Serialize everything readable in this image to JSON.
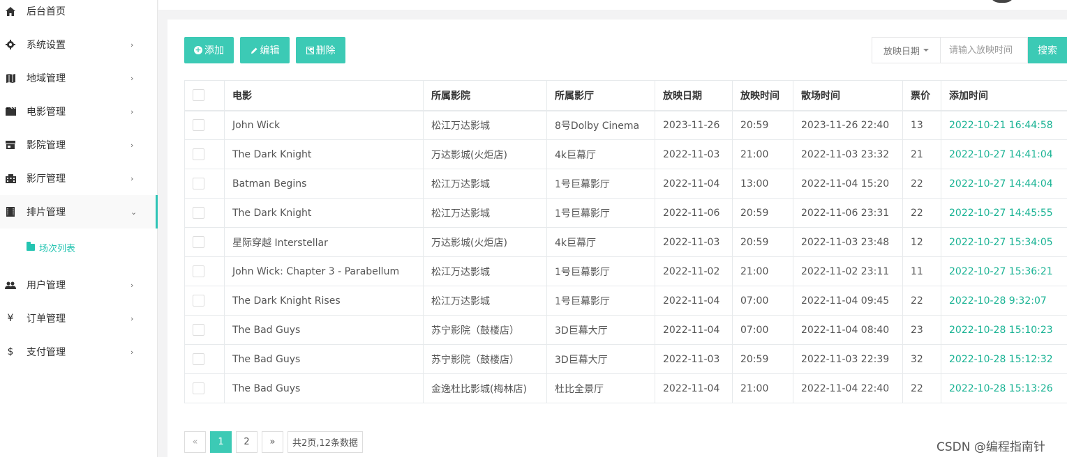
{
  "sidebar": {
    "items": [
      {
        "label": "后台首页",
        "icon": "home-icon"
      },
      {
        "label": "系统设置",
        "icon": "gear-icon"
      },
      {
        "label": "地域管理",
        "icon": "map-icon"
      },
      {
        "label": "电影管理",
        "icon": "film-icon"
      },
      {
        "label": "影院管理",
        "icon": "store-icon"
      },
      {
        "label": "影厅管理",
        "icon": "building-icon"
      },
      {
        "label": "排片管理",
        "icon": "schedule-icon"
      },
      {
        "label": "用户管理",
        "icon": "users-icon"
      },
      {
        "label": "订单管理",
        "icon": "yen-icon"
      },
      {
        "label": "支付管理",
        "icon": "dollar-icon"
      }
    ],
    "sub_item": {
      "label": "场次列表",
      "icon": "folder-icon"
    }
  },
  "toolbar": {
    "add_label": "添加",
    "edit_label": "编辑",
    "delete_label": "删除"
  },
  "search": {
    "field_select": "放映日期",
    "placeholder": "请输入放映时间",
    "button_label": "搜索"
  },
  "table": {
    "headers": [
      "电影",
      "所属影院",
      "所属影厅",
      "放映日期",
      "放映时间",
      "散场时间",
      "票价",
      "添加时间"
    ],
    "rows": [
      [
        "John Wick",
        "松江万达影城",
        "8号Dolby Cinema",
        "2023-11-26",
        "20:59",
        "2023-11-26 22:40",
        "13",
        "2022-10-21 16:44:58"
      ],
      [
        "The Dark Knight",
        "万达影城(火炬店)",
        "4k巨幕厅",
        "2022-11-03",
        "21:00",
        "2022-11-03 23:32",
        "21",
        "2022-10-27 14:41:04"
      ],
      [
        "Batman Begins",
        "松江万达影城",
        "1号巨幕影厅",
        "2022-11-04",
        "13:00",
        "2022-11-04 15:20",
        "22",
        "2022-10-27 14:44:04"
      ],
      [
        "The Dark Knight",
        "松江万达影城",
        "1号巨幕影厅",
        "2022-11-06",
        "20:59",
        "2022-11-06 23:31",
        "22",
        "2022-10-27 14:45:55"
      ],
      [
        "星际穿越 Interstellar",
        "万达影城(火炬店)",
        "4k巨幕厅",
        "2022-11-03",
        "20:59",
        "2022-11-03 23:48",
        "12",
        "2022-10-27 15:34:05"
      ],
      [
        "John Wick: Chapter 3 - Parabellum",
        "松江万达影城",
        "1号巨幕影厅",
        "2022-11-02",
        "21:00",
        "2022-11-02 23:11",
        "11",
        "2022-10-27 15:36:21"
      ],
      [
        "The Dark Knight Rises",
        "松江万达影城",
        "1号巨幕影厅",
        "2022-11-04",
        "07:00",
        "2022-11-04 09:45",
        "22",
        "2022-10-28 9:32:07"
      ],
      [
        "The Bad Guys",
        "苏宁影院（鼓楼店）",
        "3D巨幕大厅",
        "2022-11-04",
        "07:00",
        "2022-11-04 08:40",
        "23",
        "2022-10-28 15:10:23"
      ],
      [
        "The Bad Guys",
        "苏宁影院（鼓楼店）",
        "3D巨幕大厅",
        "2022-11-03",
        "20:59",
        "2022-11-03 22:39",
        "32",
        "2022-10-28 15:12:32"
      ],
      [
        "The Bad Guys",
        "金逸杜比影城(梅林店)",
        "杜比全景厅",
        "2022-11-04",
        "21:00",
        "2022-11-04 22:40",
        "22",
        "2022-10-28 15:13:26"
      ]
    ]
  },
  "pagination": {
    "prev": "«",
    "pages": [
      "1",
      "2"
    ],
    "current": "1",
    "next": "»",
    "info": "共2页,12条数据"
  },
  "watermark": "CSDN @编程指南针",
  "colors": {
    "accent": "#3ccab5",
    "added_time": "#1ab394"
  }
}
